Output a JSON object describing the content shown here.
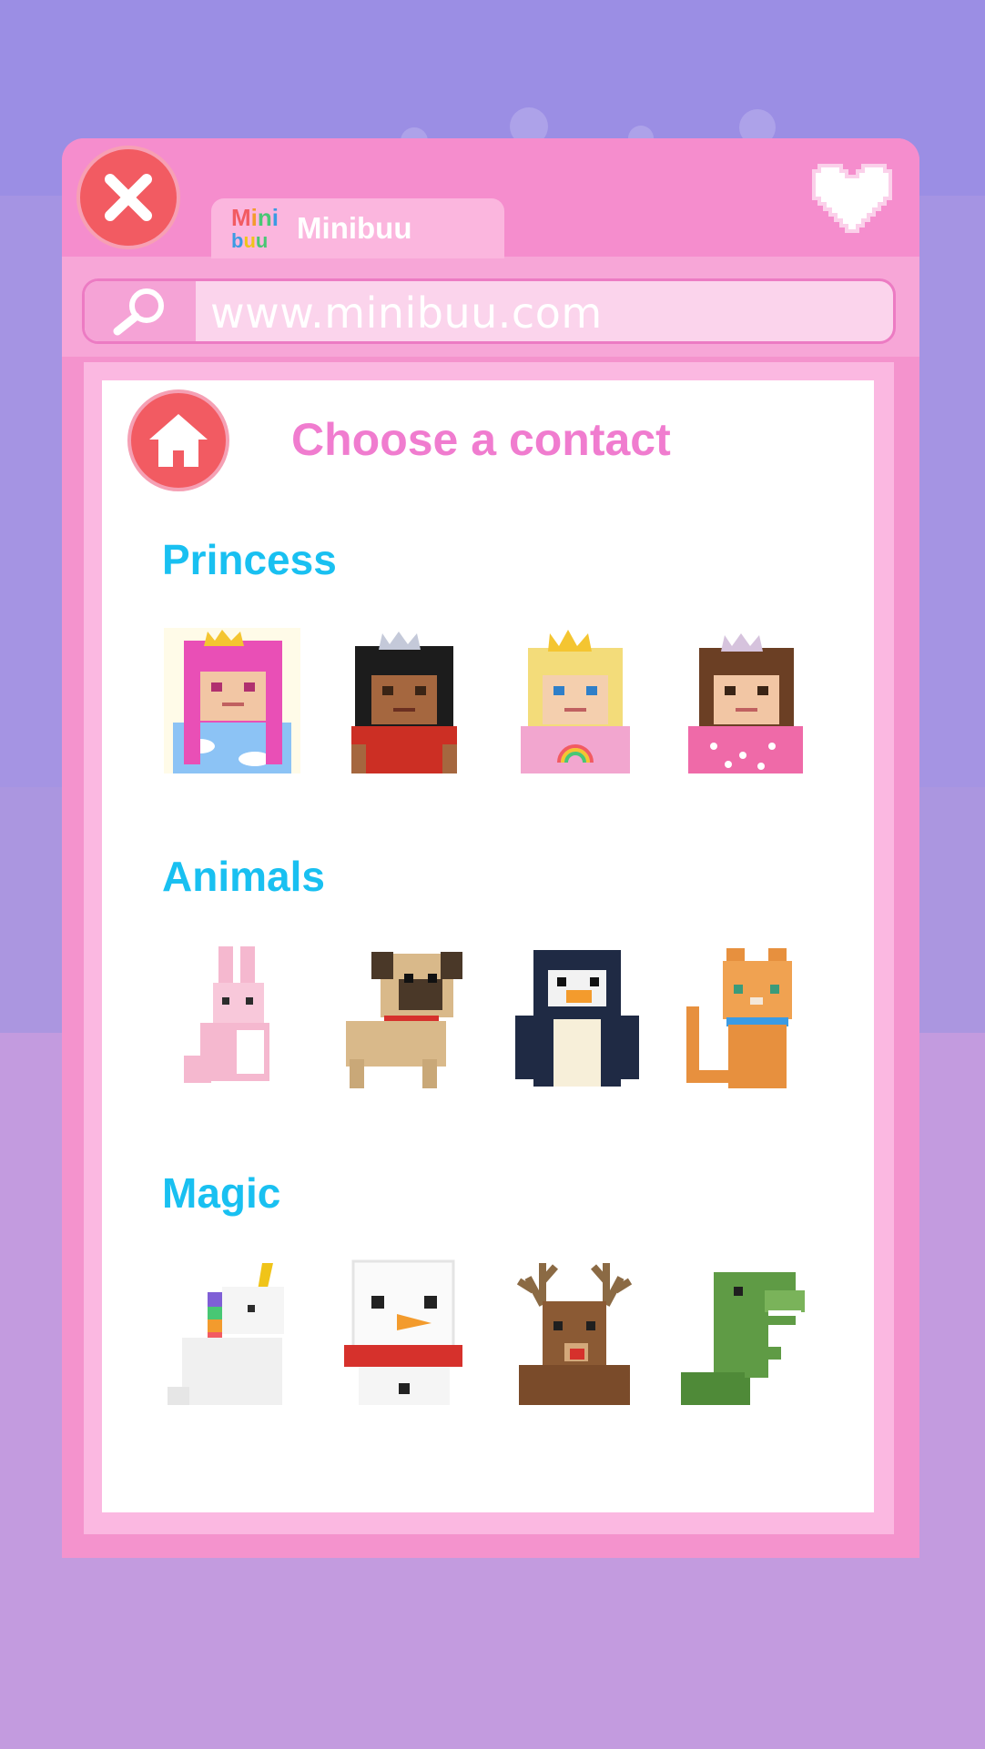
{
  "app": {
    "tab_title": "Minibuu",
    "logo_top": [
      "M",
      "i",
      "n",
      "i"
    ],
    "logo_bottom": [
      "b",
      "u",
      "u"
    ],
    "logo_colors": [
      "#f25b62",
      "#f39b2d",
      "#48c774",
      "#3b9be3",
      "#f0c419"
    ],
    "address": "www.minibuu.com"
  },
  "page": {
    "title": "Choose a contact"
  },
  "sections": [
    {
      "title": "Princess",
      "items": [
        {
          "name": "princess-pink-hair",
          "icon": "princess-pink-avatar"
        },
        {
          "name": "princess-black-hair",
          "icon": "princess-black-avatar"
        },
        {
          "name": "princess-blonde",
          "icon": "princess-blonde-avatar"
        },
        {
          "name": "princess-brown-hair",
          "icon": "princess-brown-avatar"
        }
      ]
    },
    {
      "title": "Animals",
      "items": [
        {
          "name": "bunny",
          "icon": "bunny-avatar"
        },
        {
          "name": "pug",
          "icon": "pug-avatar"
        },
        {
          "name": "penguin",
          "icon": "penguin-avatar"
        },
        {
          "name": "cat",
          "icon": "cat-avatar"
        }
      ]
    },
    {
      "title": "Magic",
      "items": [
        {
          "name": "unicorn",
          "icon": "unicorn-avatar"
        },
        {
          "name": "snowman",
          "icon": "snowman-avatar"
        },
        {
          "name": "reindeer",
          "icon": "reindeer-avatar"
        },
        {
          "name": "dinosaur",
          "icon": "dinosaur-avatar"
        }
      ]
    }
  ],
  "colors": {
    "accent_pink": "#f07ccf",
    "section_blue": "#19c0f1",
    "close_red": "#f25b62",
    "background_purple": "#a594e3"
  }
}
